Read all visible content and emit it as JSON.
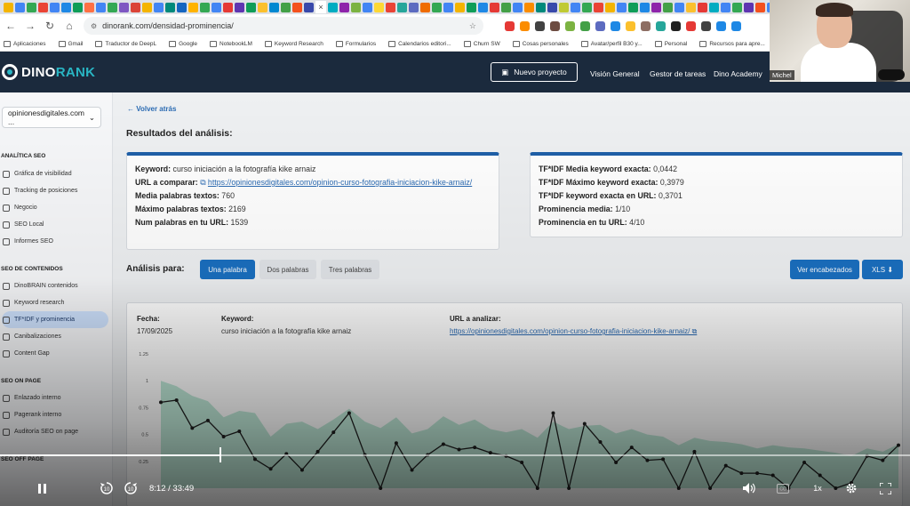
{
  "browser": {
    "url": "dinorank.com/densidad-prominencia/",
    "tab_colors": [
      "#f4b400",
      "#4285f4",
      "#34a853",
      "#ea4335",
      "#4285f4",
      "#1e88e5",
      "#0f9d58",
      "#ff7043",
      "#4285f4",
      "#34a853",
      "#7e57c2",
      "#db4437",
      "#f4b400",
      "#4285f4",
      "#00897b",
      "#1565c0",
      "#ffb300",
      "#34a853",
      "#4285f4",
      "#e53935",
      "#5e35b1",
      "#0f9d58",
      "#fbc02d",
      "#0288d1",
      "#43a047",
      "#f4511e",
      "#3949ab",
      "#00acc1",
      "#8e24aa",
      "#7cb342",
      "#4285f4",
      "#fdd835",
      "#ea4335",
      "#26a69a",
      "#5c6bc0",
      "#ef6c00",
      "#34a853",
      "#4285f4",
      "#f4b400",
      "#0f9d58",
      "#1e88e5",
      "#e53935",
      "#43a047",
      "#4285f4",
      "#fb8c00",
      "#00897b",
      "#3949ab",
      "#c0ca33",
      "#4285f4",
      "#34a853",
      "#ea4335",
      "#f4b400",
      "#4285f4",
      "#0f9d58",
      "#1e88e5",
      "#8e24aa",
      "#43a047",
      "#4285f4",
      "#fbc02d",
      "#e53935",
      "#00acc1",
      "#4285f4",
      "#34a853",
      "#5e35b1",
      "#f4511e",
      "#4285f4",
      "#0288d1",
      "#43a047",
      "#f4b400",
      "#4285f4",
      "#e53935",
      "#34a853",
      "#1565c0",
      "#fdd835",
      "#4285f4",
      "#0f9d58"
    ],
    "ext_colors": [
      "#e53935",
      "#fb8c00",
      "#424242",
      "#6d4c41",
      "#7cb342",
      "#43a047",
      "#5c6bc0",
      "#1e88e5",
      "#fbc02d",
      "#8d6e63",
      "#26a69a",
      "#212121",
      "#e53935",
      "#424242",
      "#1e88e5",
      "#1e88e5"
    ],
    "bookmarks": [
      "Aplicaciones",
      "Gmail",
      "Traductor de DeepL",
      "Google",
      "NotebookLM",
      "Keyword Research",
      "Formularios",
      "Calendarios editori...",
      "Churn SW",
      "Cosas personales",
      "Avatar/perfil B30 y...",
      "Personal",
      "Recursos para apre..."
    ]
  },
  "header": {
    "logo_a": "DINO",
    "logo_b": "RANK",
    "new_project": "Nuevo proyecto",
    "nav": [
      "Visión General",
      "Gestor de tareas",
      "Dino Academy"
    ],
    "webcam_name": "Michel"
  },
  "sidebar": {
    "site": "opinionesdigitales.com ...",
    "sections": [
      {
        "title": "ANALÍTICA SEO",
        "items": [
          "Gráfica de visibilidad",
          "Tracking de posiciones",
          "Negocio",
          "SEO Local",
          "Informes SEO"
        ]
      },
      {
        "title": "SEO DE CONTENIDOS",
        "items": [
          "DinoBRAIN contenidos",
          "Keyword research",
          "TF*IDF y prominencia",
          "Canibalizaciones",
          "Content Gap"
        ]
      },
      {
        "title": "SEO ON PAGE",
        "items": [
          "Enlazado interno",
          "Pagerank interno",
          "Auditoría SEO on page"
        ]
      },
      {
        "title": "SEO OFF PAGE",
        "items": []
      }
    ]
  },
  "main": {
    "back": "← Volver atrás",
    "title": "Resultados del análisis:",
    "left_card": {
      "keyword_label": "Keyword:",
      "keyword": "curso iniciación a la fotografía kike arnaiz",
      "url_label": "URL a comparar:",
      "url_icon": "⧉",
      "url": "https://opinionesdigitales.com/opinion-curso-fotografia-iniciacion-kike-arnaiz/",
      "avg_label": "Media palabras textos:",
      "avg": "760",
      "max_label": "Máximo palabras textos:",
      "max": "2169",
      "num_label": "Num palabras en tu URL:",
      "num": "1539"
    },
    "right_card": {
      "l1": "TF*IDF Media keyword exacta:",
      "v1": "0,0442",
      "l2": "TF*IDF Máximo keyword exacta:",
      "v2": "0,3979",
      "l3": "TF*IDF keyword exacta en URL:",
      "v3": "0,3701",
      "l4": "Prominencia media:",
      "v4": "1/10",
      "l5": "Prominencia en tu URL:",
      "v5": "4/10"
    },
    "analysis_label": "Análisis para:",
    "tabs": [
      "Una palabra",
      "Dos palabras",
      "Tres palabras"
    ],
    "btn_headers": "Ver encabezados",
    "btn_xls": "XLS ⬇",
    "details": {
      "date_label": "Fecha:",
      "date": "17/09/2025",
      "kw_label": "Keyword:",
      "kw": "curso iniciación a la fotografía kike arnaiz",
      "url_label": "URL a analizar:",
      "url": "https://opinionesdigitales.com/opinion-curso-fotografia-iniciacion-kike-arnaiz/ ⧉"
    }
  },
  "chart_data": {
    "type": "line",
    "yticks": [
      "1.25",
      "1",
      "0.75",
      "0.5",
      "0.25"
    ],
    "ylim": [
      0,
      1.25
    ],
    "series": [
      {
        "values": [
          0.8,
          0.82,
          0.56,
          0.63,
          0.48,
          0.53,
          0.27,
          0.18,
          0.32,
          0.17,
          0.34,
          0.52,
          0.7,
          0.31,
          0.0,
          0.42,
          0.17,
          0.31,
          0.41,
          0.36,
          0.38,
          0.33,
          0.3,
          0.24,
          0.0,
          0.7,
          0.0,
          0.6,
          0.43,
          0.24,
          0.38,
          0.26,
          0.27,
          0.0,
          0.34,
          0.0,
          0.21,
          0.14,
          0.14,
          0.12,
          0.0,
          0.24,
          0.12,
          0.0,
          0.05,
          0.3,
          0.26,
          0.4
        ]
      },
      {
        "values": [
          1.0,
          0.95,
          0.86,
          0.81,
          0.66,
          0.72,
          0.7,
          0.48,
          0.6,
          0.62,
          0.55,
          0.64,
          0.74,
          0.62,
          0.56,
          0.66,
          0.51,
          0.55,
          0.67,
          0.59,
          0.64,
          0.55,
          0.52,
          0.55,
          0.47,
          0.62,
          0.55,
          0.58,
          0.59,
          0.51,
          0.55,
          0.5,
          0.48,
          0.4,
          0.47,
          0.44,
          0.43,
          0.41,
          0.37,
          0.4,
          0.38,
          0.37,
          0.35,
          0.33,
          0.3,
          0.37,
          0.34,
          0.41
        ]
      }
    ]
  },
  "player": {
    "time": "8:12 / 33:49",
    "progress": 0.2425,
    "icons": [
      "pause-icon",
      "rewind-10-icon",
      "forward-10-icon",
      "volume-icon",
      "captions-icon",
      "speed-icon",
      "settings-icon",
      "fullscreen-icon"
    ],
    "speed": "1x"
  }
}
